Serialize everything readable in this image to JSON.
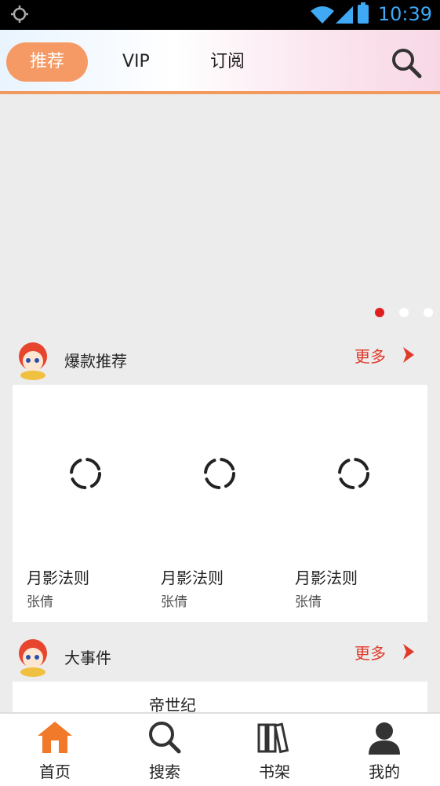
{
  "status_bar": {
    "time": "10:39"
  },
  "top_tabs": {
    "recommend": "推荐",
    "vip": "VIP",
    "subscribe": "订阅"
  },
  "sections": [
    {
      "title": "爆款推荐",
      "more": "更多",
      "books": [
        {
          "title": "月影法则",
          "author": "张倩"
        },
        {
          "title": "月影法则",
          "author": "张倩"
        },
        {
          "title": "月影法则",
          "author": "张倩"
        }
      ]
    },
    {
      "title": "大事件",
      "more": "更多",
      "books": [
        {
          "title": "帝世纪"
        }
      ]
    }
  ],
  "bottom_nav": {
    "home": "首页",
    "search": "搜索",
    "shelf": "书架",
    "mine": "我的"
  },
  "colors": {
    "accent": "#f59a65",
    "more_red": "#e03a2a",
    "status_blue": "#3fa9f5",
    "home_icon": "#f07a2a"
  }
}
